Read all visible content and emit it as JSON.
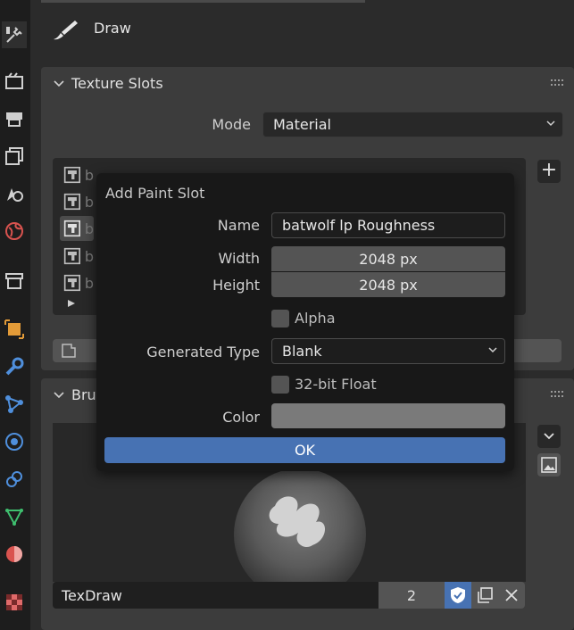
{
  "header": {
    "title": "Draw",
    "icon": "brush-icon"
  },
  "texture_slots": {
    "title": "Texture Slots",
    "mode_label": "Mode",
    "mode_value": "Material",
    "slot_prefix": [
      "b",
      "b",
      "b",
      "b",
      "b"
    ],
    "add_icon": "+"
  },
  "brush_panel": {
    "title": "Brus",
    "brush_name": "TexDraw",
    "users": "2"
  },
  "dialog": {
    "title": "Add Paint Slot",
    "name_label": "Name",
    "name_value": "batwolf lp Roughness",
    "width_label": "Width",
    "width_value": "2048 px",
    "height_label": "Height",
    "height_value": "2048 px",
    "alpha_label": "Alpha",
    "generated_type_label": "Generated Type",
    "generated_type_value": "Blank",
    "float_label": "32-bit Float",
    "color_label": "Color",
    "ok_label": "OK"
  },
  "colors": {
    "accent": "#4772b3",
    "swatch": "#7a7a7a"
  }
}
